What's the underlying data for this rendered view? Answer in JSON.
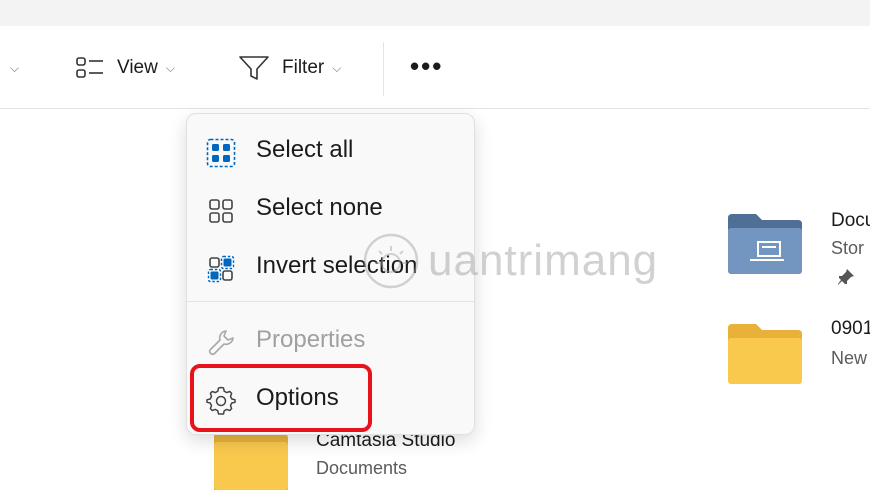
{
  "toolbar": {
    "view_label": "View",
    "filter_label": "Filter",
    "more_label": "•••"
  },
  "menu": {
    "items": [
      {
        "label": "Select all",
        "icon": "select-all-icon",
        "disabled": false
      },
      {
        "label": "Select none",
        "icon": "select-none-icon",
        "disabled": false
      },
      {
        "label": "Invert selection",
        "icon": "invert-selection-icon",
        "disabled": false
      },
      {
        "label": "Properties",
        "icon": "wrench-icon",
        "disabled": true
      },
      {
        "label": "Options",
        "icon": "gear-icon",
        "disabled": false,
        "highlighted": true
      }
    ]
  },
  "files": [
    {
      "name": "Docu",
      "sub": "Stor",
      "icon": "documents-folder-icon",
      "pinned": true
    },
    {
      "name": "0901",
      "sub": "New",
      "icon": "folder-icon"
    },
    {
      "name": "Camtasia Studio",
      "sub": "Documents",
      "icon": "folder-icon"
    }
  ],
  "watermark": {
    "text": "uantrimang"
  },
  "colors": {
    "accent": "#0067c0",
    "highlight": "#e8121b",
    "folder": "#f8c94d",
    "doc_folder": "#6c8fb6"
  }
}
